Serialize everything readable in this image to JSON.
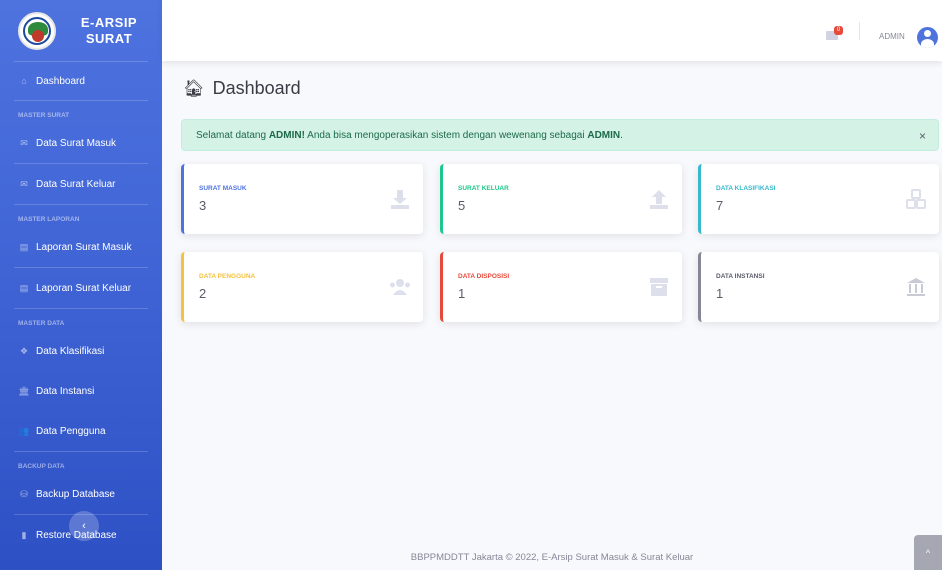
{
  "brand": {
    "line1": "E-ARSIP",
    "line2": "SURAT"
  },
  "sidebar": {
    "dashboard": "Dashboard",
    "headings": [
      "MASTER SURAT",
      "MASTER LAPORAN",
      "MASTER DATA",
      "BACKUP DATA"
    ],
    "items": [
      {
        "label": "Data Surat Masuk",
        "icon": "envelope-icon"
      },
      {
        "label": "Data Surat Keluar",
        "icon": "envelope-icon"
      },
      {
        "label": "Laporan Surat Masuk",
        "icon": "print-icon"
      },
      {
        "label": "Laporan Surat Keluar",
        "icon": "print-icon"
      },
      {
        "label": "Data Klasifikasi",
        "icon": "cubes-icon"
      },
      {
        "label": "Data Instansi",
        "icon": "university-icon"
      },
      {
        "label": "Data Pengguna",
        "icon": "users-icon"
      },
      {
        "label": "Backup Database",
        "icon": "database-icon"
      },
      {
        "label": "Restore Database",
        "icon": "file-icon"
      }
    ],
    "toggle_symbol": "‹"
  },
  "topbar": {
    "badge": "0",
    "user": "ADMIN"
  },
  "page": {
    "title": "Dashboard"
  },
  "alert": {
    "pre": "Selamat datang ",
    "user1": "ADMIN!",
    "mid": " Anda bisa mengoperasikan sistem dengan wewenang sebagai ",
    "user2": "ADMIN",
    "post": ".",
    "close": "×"
  },
  "cards": [
    {
      "label": "SURAT MASUK",
      "value": "3",
      "color": "#4e73df",
      "icon": "download-icon"
    },
    {
      "label": "SURAT KELUAR",
      "value": "5",
      "color": "#1cc88a",
      "icon": "upload-icon"
    },
    {
      "label": "DATA KLASIFIKASI",
      "value": "7",
      "color": "#36b9cc",
      "icon": "cubes-icon"
    },
    {
      "label": "DATA PENGGUNA",
      "value": "2",
      "color": "#f6c23e",
      "icon": "users-icon"
    },
    {
      "label": "DATA DISPOSISI",
      "value": "1",
      "color": "#e74a3b",
      "icon": "archive-icon"
    },
    {
      "label": "DATA INSTANSI",
      "value": "1",
      "color": "#858796",
      "icon": "university-icon"
    }
  ],
  "footer": {
    "text": "BBPPMDDTT Jakarta © 2022, E-Arsip Surat Masuk & Surat Keluar"
  },
  "scroll_top": "^"
}
